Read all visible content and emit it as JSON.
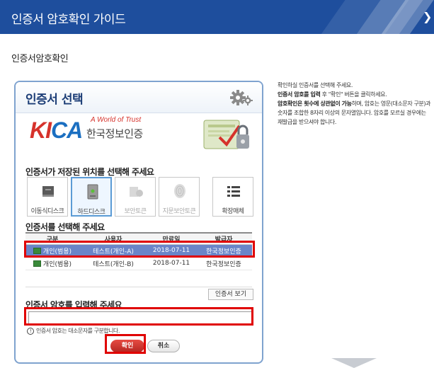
{
  "header": {
    "title": "인증서 암호확인 가이드",
    "close_glyph": "❯"
  },
  "section": {
    "title": "인증서암호확인"
  },
  "dialog": {
    "title": "인증서 선택",
    "logo": {
      "brand_k": "K",
      "brand_i": "I",
      "brand_ca": "CA",
      "tagline": "A World of Trust",
      "korean_name": "한국정보인증"
    },
    "location_label": "인증서가 저장된 위치를 선택해 주세요",
    "media": [
      {
        "label": "이동식디스크",
        "icon": "usb-drive-icon",
        "state": "normal"
      },
      {
        "label": "하드디스크",
        "icon": "hard-disk-icon",
        "state": "selected"
      },
      {
        "label": "보안토큰",
        "icon": "security-token-icon",
        "state": "disabled"
      },
      {
        "label": "지문보안토큰",
        "icon": "fingerprint-icon",
        "state": "disabled"
      },
      {
        "label": "확장매체",
        "icon": "list-icon",
        "state": "normal"
      }
    ],
    "select_label": "인증서를 선택해 주세요",
    "table": {
      "headers": [
        "구분",
        "사용자",
        "만료일",
        "발급자"
      ],
      "rows": [
        {
          "type": "개인(범용)",
          "user": "테스트(개인-A)",
          "expires": "2018-07-11",
          "issuer": "한국정보인증",
          "selected": true
        },
        {
          "type": "개인(범용)",
          "user": "테스트(개인-B)",
          "expires": "2018-07-11",
          "issuer": "한국정보인증",
          "selected": false
        }
      ]
    },
    "view_cert_label": "인증서 보기",
    "password_label": "인증서 암호를 입력해 주세요",
    "password_value": "",
    "password_note": "인증서 암호는 대소문자를 구분합니다.",
    "ok_label": "확인",
    "cancel_label": "취소"
  },
  "instructions": {
    "line1": "확인하실 인증서를 선택해 주세요.",
    "line2_bold": "인증서 암호를 입력",
    "line2_rest": " 후 \"확인\" 버튼을 클릭하세요.",
    "line3_bold": "암호확인은 횟수에 상관없이 가능",
    "line3_rest": "하며, 암호는 영문(대소문자 구분)과 숫자를 조합한 8자리 이상의 문자열입니다. 암호를 모르실 경우에는 재발급을 받으셔야 합니다."
  },
  "colors": {
    "header_bg": "#1e4e9d",
    "highlight": "#e00000",
    "selected_row": "#6a85c8",
    "ok_button": "#d63a33"
  }
}
